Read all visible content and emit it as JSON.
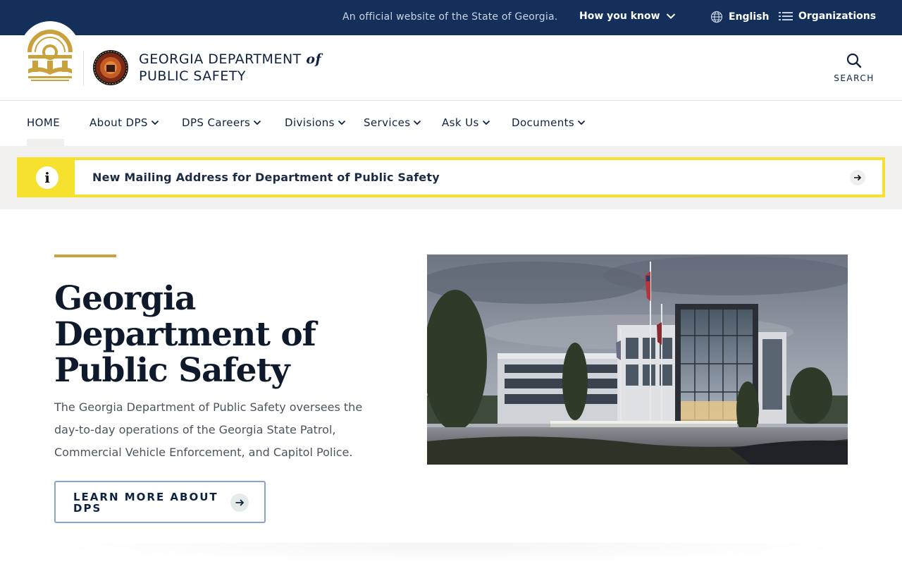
{
  "topbar": {
    "official_text": "An official website of the State of Georgia.",
    "how_you_know": "How you know",
    "language": "English",
    "organizations": "Organizations"
  },
  "header": {
    "agency_line1": "GEORGIA DEPARTMENT",
    "agency_of": "of",
    "agency_line2": "PUBLIC SAFETY",
    "search_label": "SEARCH"
  },
  "nav": {
    "items": [
      {
        "label": "HOME",
        "has_dropdown": false,
        "active": true
      },
      {
        "label": "About DPS",
        "has_dropdown": true
      },
      {
        "label": "DPS Careers",
        "has_dropdown": true
      },
      {
        "label": "Divisions",
        "has_dropdown": true
      },
      {
        "label": "Services",
        "has_dropdown": true
      },
      {
        "label": "Ask Us",
        "has_dropdown": true
      },
      {
        "label": "Documents",
        "has_dropdown": true
      }
    ]
  },
  "alert": {
    "text": "New Mailing Address for Department of Public Safety",
    "icon": "info-icon"
  },
  "hero": {
    "title_line1": "Georgia",
    "title_line2": "Department of",
    "title_line3": "Public Safety",
    "description": "The Georgia Department of Public Safety oversees the day-to-day operations of the Georgia State Patrol, Commercial Vehicle Enforcement, and Capitol Police.",
    "button_label": "LEARN MORE ABOUT DPS"
  },
  "colors": {
    "navy": "#14305a",
    "gold": "#c9a23e",
    "alert_yellow": "#f5e12e",
    "button_border": "#8aa5c8"
  }
}
